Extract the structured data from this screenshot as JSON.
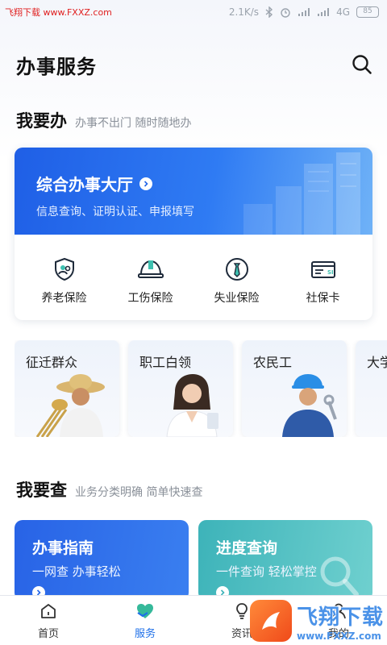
{
  "status_bar": {
    "watermark": "飞翔下载 www.FXXZ.com",
    "speed": "2.1K/s",
    "network": "4G",
    "battery": "85"
  },
  "header": {
    "title": "办事服务",
    "search_icon": "search-icon"
  },
  "section_do": {
    "title": "我要办",
    "subtitle": "办事不出门 随时随地办"
  },
  "hall": {
    "title": "综合办事大厅",
    "subtitle": "信息查询、证明认证、申报填写",
    "items": [
      {
        "label": "养老保险",
        "icon": "pension-shield-icon"
      },
      {
        "label": "工伤保险",
        "icon": "helmet-icon"
      },
      {
        "label": "失业保险",
        "icon": "tie-icon"
      },
      {
        "label": "社保卡",
        "icon": "card-icon"
      }
    ]
  },
  "groups": [
    {
      "label": "征迁群众"
    },
    {
      "label": "职工白领"
    },
    {
      "label": "农民工"
    },
    {
      "label": "大学"
    }
  ],
  "section_query": {
    "title": "我要查",
    "subtitle": "业务分类明确 简单快速查"
  },
  "query_cards": [
    {
      "title": "办事指南",
      "subtitle": "一网查 办事轻松",
      "color": "#2f6fe6"
    },
    {
      "title": "进度查询",
      "subtitle": "一件查询 轻松掌控",
      "color": "#4bbcc0"
    }
  ],
  "nav": [
    {
      "label": "首页",
      "icon": "home-icon"
    },
    {
      "label": "服务",
      "icon": "heart-hands-icon",
      "active": true
    },
    {
      "label": "资讯",
      "icon": "bulb-icon"
    },
    {
      "label": "我的",
      "icon": "user-icon"
    }
  ],
  "watermark": {
    "name": "飞翔下载",
    "url": "www.FXXZ.com"
  },
  "colors": {
    "accent": "#1e6fe8",
    "hall_blue": "#1f5fe6",
    "teal": "#4bbcc0"
  }
}
